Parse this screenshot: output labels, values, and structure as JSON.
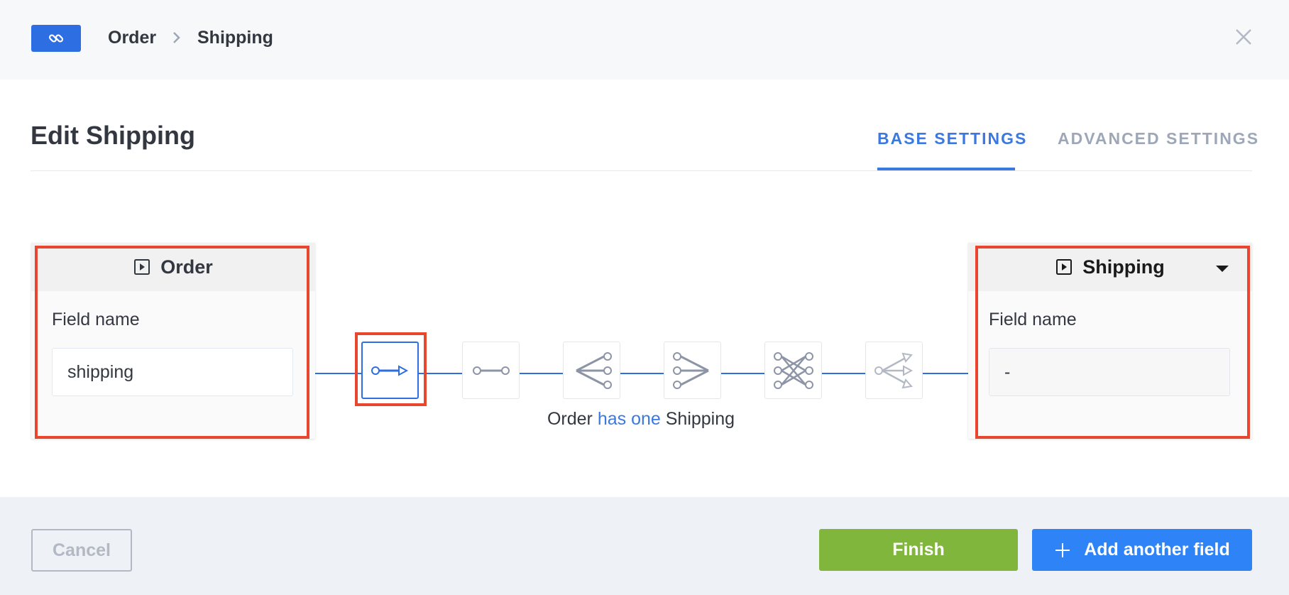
{
  "header": {
    "badge_icon": "link-icon",
    "breadcrumb": [
      "Order",
      "Shipping"
    ],
    "close_icon": "close-icon"
  },
  "title": "Edit Shipping",
  "tabs": [
    {
      "label": "BASE SETTINGS",
      "active": true
    },
    {
      "label": "ADVANCED SETTINGS",
      "active": false
    }
  ],
  "left_card": {
    "icon": "collection-type-icon",
    "title": "Order",
    "field_label": "Field name",
    "field_value": "shipping"
  },
  "right_card": {
    "icon": "collection-type-icon",
    "title": "Shipping",
    "field_label": "Field name",
    "field_value": "-"
  },
  "relations": [
    {
      "icon": "one-way-relation-icon",
      "selected": true
    },
    {
      "icon": "one-to-one-relation-icon",
      "selected": false
    },
    {
      "icon": "one-to-many-relation-icon",
      "selected": false
    },
    {
      "icon": "many-to-one-relation-icon",
      "selected": false
    },
    {
      "icon": "many-to-many-relation-icon",
      "selected": false
    },
    {
      "icon": "many-way-relation-icon",
      "selected": false
    }
  ],
  "relation_description": {
    "source": "Order",
    "relation": "has one",
    "target": "Shipping"
  },
  "footer": {
    "cancel_label": "Cancel",
    "finish_label": "Finish",
    "add_label": "Add another field"
  },
  "colors": {
    "accent": "#3b79e0",
    "primary_button": "#2e83f6",
    "finish_button": "#7fb63b",
    "highlight": "#e8462f"
  }
}
